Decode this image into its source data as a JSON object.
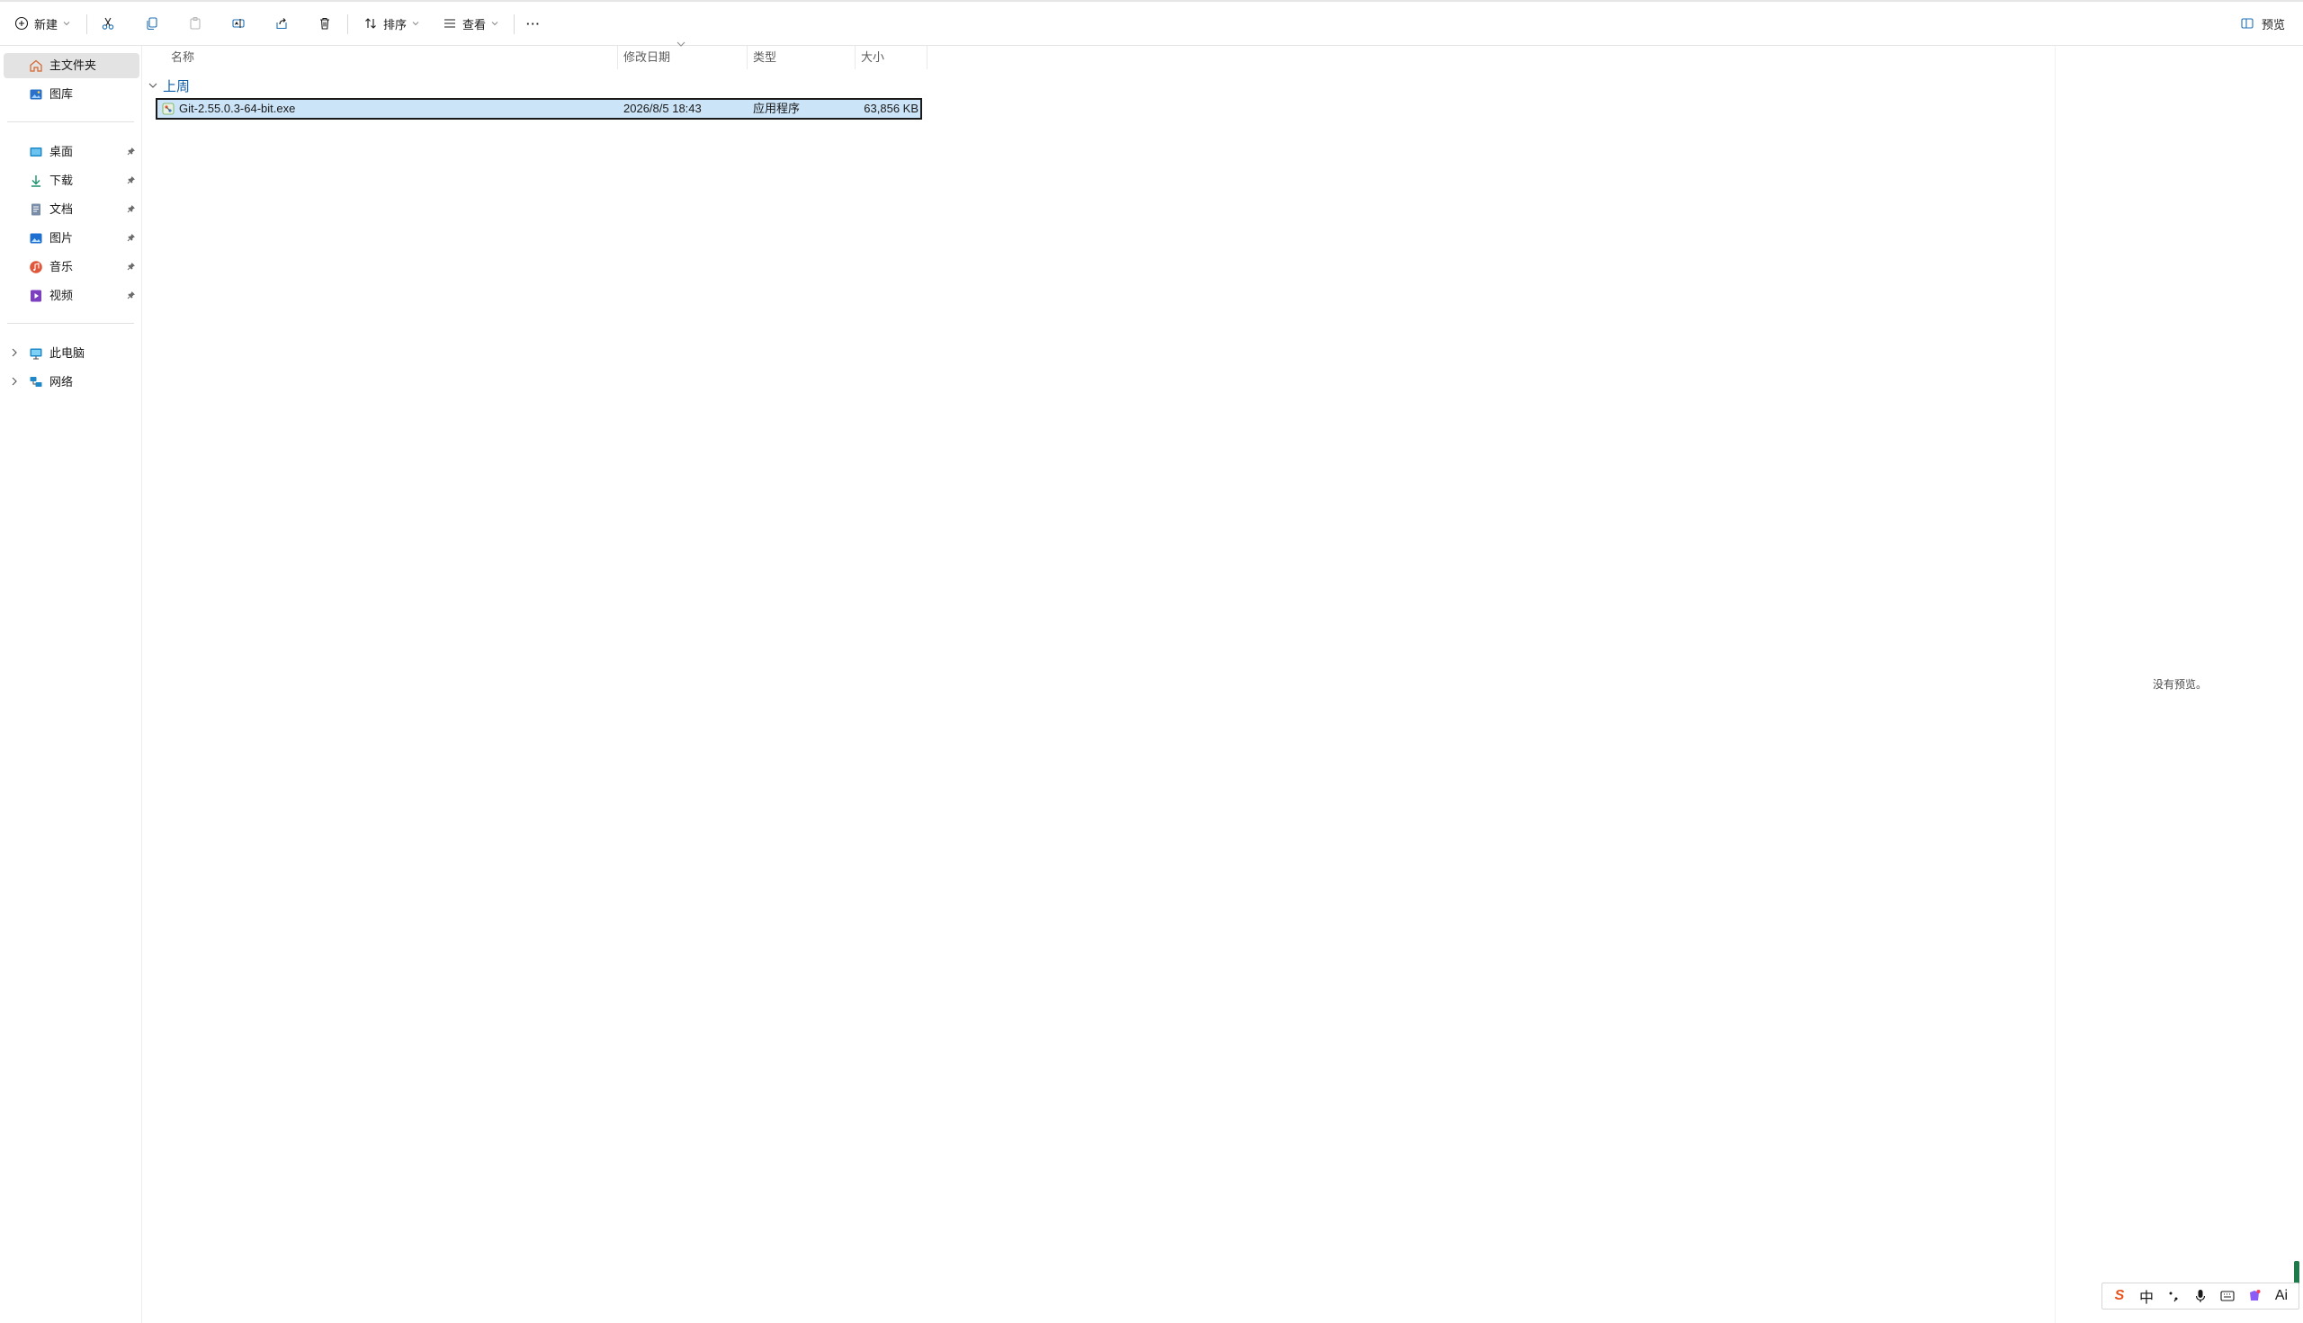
{
  "toolbar": {
    "new_label": "新建",
    "sort_label": "排序",
    "view_label": "查看",
    "more_label": "···",
    "preview_label": "预览"
  },
  "sidebar": {
    "home": "主文件夹",
    "gallery": "图库",
    "pinned": [
      {
        "label": "桌面",
        "icon": "desktop-icon"
      },
      {
        "label": "下载",
        "icon": "download-icon"
      },
      {
        "label": "文档",
        "icon": "document-icon"
      },
      {
        "label": "图片",
        "icon": "pictures-icon"
      },
      {
        "label": "音乐",
        "icon": "music-icon"
      },
      {
        "label": "视频",
        "icon": "video-icon"
      }
    ],
    "this_pc": "此电脑",
    "network": "网络"
  },
  "columns": {
    "name": "名称",
    "modified": "修改日期",
    "type": "类型",
    "size": "大小"
  },
  "group": {
    "title": "上周"
  },
  "files": [
    {
      "name": "Git-2.55.0.3-64-bit.exe",
      "modified": "2026/8/5 18:43",
      "type": "应用程序",
      "size": "63,856 KB"
    }
  ],
  "preview": {
    "empty_text": "没有预览。"
  },
  "ime": {
    "brand": "S",
    "mode": "中",
    "ai": "Ai"
  },
  "colors": {
    "selection": "#cce4f7",
    "accent": "#0f5ea8",
    "sidebar_selected": "#e3e3e3"
  }
}
